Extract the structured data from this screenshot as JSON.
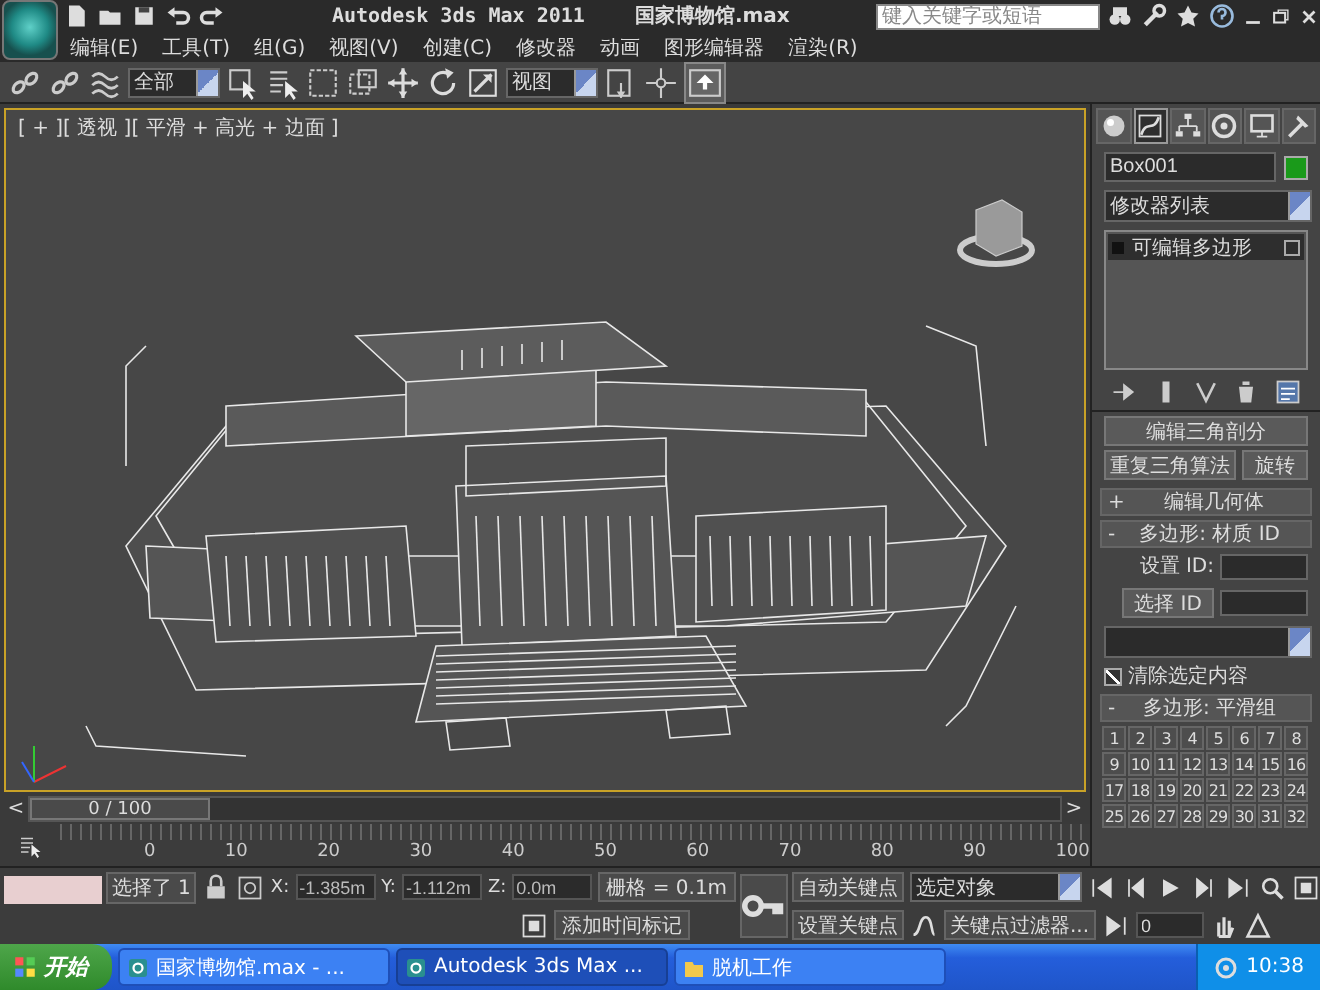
{
  "title_bar": {
    "app_title": "Autodesk 3ds Max  2011",
    "file_name": "国家博物馆.max",
    "search": {
      "placeholder": "键入关键字或短语"
    }
  },
  "menu": [
    "编辑(E)",
    "工具(T)",
    "组(G)",
    "视图(V)",
    "创建(C)",
    "修改器",
    "动画",
    "图形编辑器",
    "渲染(R)"
  ],
  "toolbar": {
    "selection_filter": "全部",
    "reference_coord": "视图"
  },
  "viewport": {
    "label": "[ + ][ 透视 ][ 平滑 + 高光 + 边面 ]"
  },
  "command_panel": {
    "object_name": "Box001",
    "modifier_list": "修改器列表",
    "stack": [
      {
        "label": "可编辑多边形",
        "selected": true
      }
    ],
    "buttons": [
      "编辑三角剖分",
      "重复三角算法",
      "旋转"
    ],
    "rollout_geometry": {
      "sign": "+",
      "title": "编辑几何体"
    },
    "rollout_material": {
      "sign": "-",
      "title": "多边形: 材质 ID",
      "set_id_label": "设置 ID:",
      "select_id_button": "选择 ID"
    },
    "clear_selection": {
      "label": "清除选定内容",
      "checked": true
    },
    "rollout_smoothing": {
      "sign": "-",
      "title": "多边形: 平滑组",
      "groups": [
        "1",
        "2",
        "3",
        "4",
        "5",
        "6",
        "7",
        "8",
        "9",
        "10",
        "11",
        "12",
        "13",
        "14",
        "15",
        "16",
        "17",
        "18",
        "19",
        "20",
        "21",
        "22",
        "23",
        "24",
        "25",
        "26",
        "27",
        "28",
        "29",
        "30",
        "31",
        "32"
      ]
    }
  },
  "timeline": {
    "prev": "<",
    "position": "0 / 100",
    "next": ">",
    "ruler": [
      "0",
      "10",
      "20",
      "30",
      "40",
      "50",
      "60",
      "70",
      "80",
      "90",
      "100"
    ]
  },
  "status": {
    "selection": "选择了 1",
    "coords": [
      {
        "axis": "X:",
        "value": "-1.385m"
      },
      {
        "axis": "Y:",
        "value": "-1.112m"
      },
      {
        "axis": "Z:",
        "value": "0.0m"
      }
    ],
    "grid": "栅格 = 0.1m",
    "add_time_tag": "添加时间标记",
    "auto_key": "自动关键点",
    "key_mode": "选定对象",
    "set_key": "设置关键点",
    "key_filters": "关键点过滤器...",
    "frame": "0"
  },
  "taskbar": {
    "start": "开始",
    "tasks": [
      {
        "label": "国家博物馆.max - ...",
        "selected": false
      },
      {
        "label": "Autodesk 3ds Max ...",
        "selected": true
      },
      {
        "label": "脱机工作",
        "selected": false
      }
    ],
    "clock": "10:38"
  }
}
